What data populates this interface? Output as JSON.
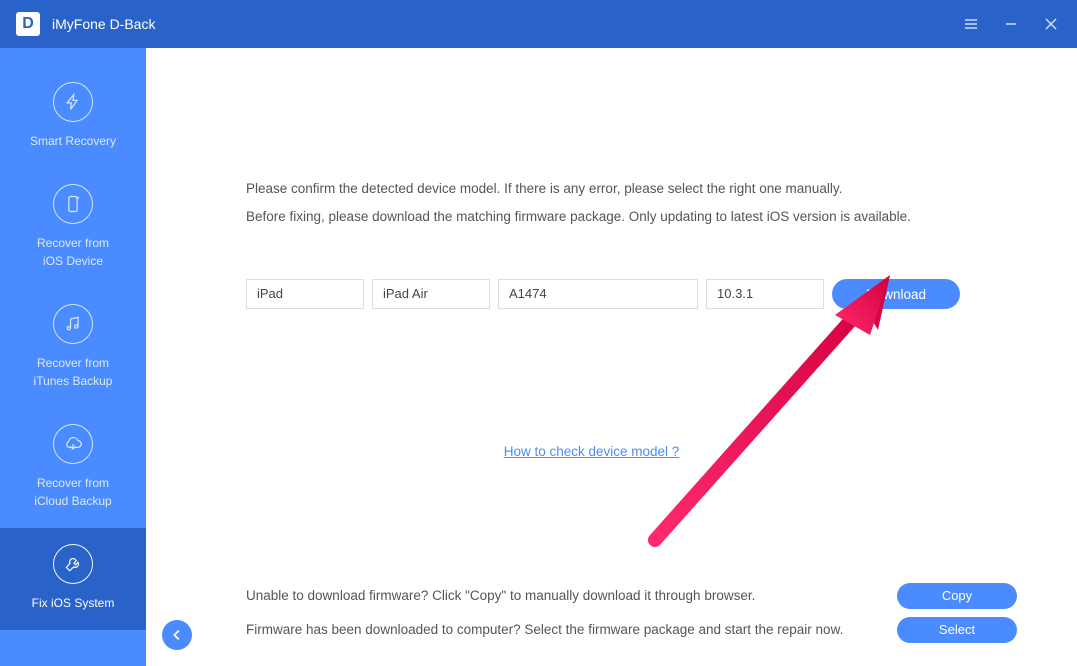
{
  "app": {
    "logo_letter": "D",
    "title": "iMyFone D-Back"
  },
  "sidebar": {
    "items": [
      {
        "label": "Smart Recovery"
      },
      {
        "label": "Recover from\niOS Device"
      },
      {
        "label": "Recover from\niTunes Backup"
      },
      {
        "label": "Recover from\niCloud Backup"
      },
      {
        "label": "Fix iOS System"
      }
    ]
  },
  "main": {
    "instruction_line1": "Please confirm the detected device model. If there is any error, please select the right one manually.",
    "instruction_line2": "Before fixing, please download the matching firmware package. Only updating to latest iOS version is available.",
    "device_type": "iPad",
    "device_model": "iPad Air",
    "device_number": "A1474",
    "ios_version": "10.3.1",
    "download_label": "Download",
    "help_link": "How to check device model ?",
    "unable_text": "Unable to download firmware? Click \"Copy\" to manually download it through browser.",
    "copy_label": "Copy",
    "downloaded_text": "Firmware has been downloaded to computer? Select the firmware package and start the repair now.",
    "select_label": "Select"
  }
}
